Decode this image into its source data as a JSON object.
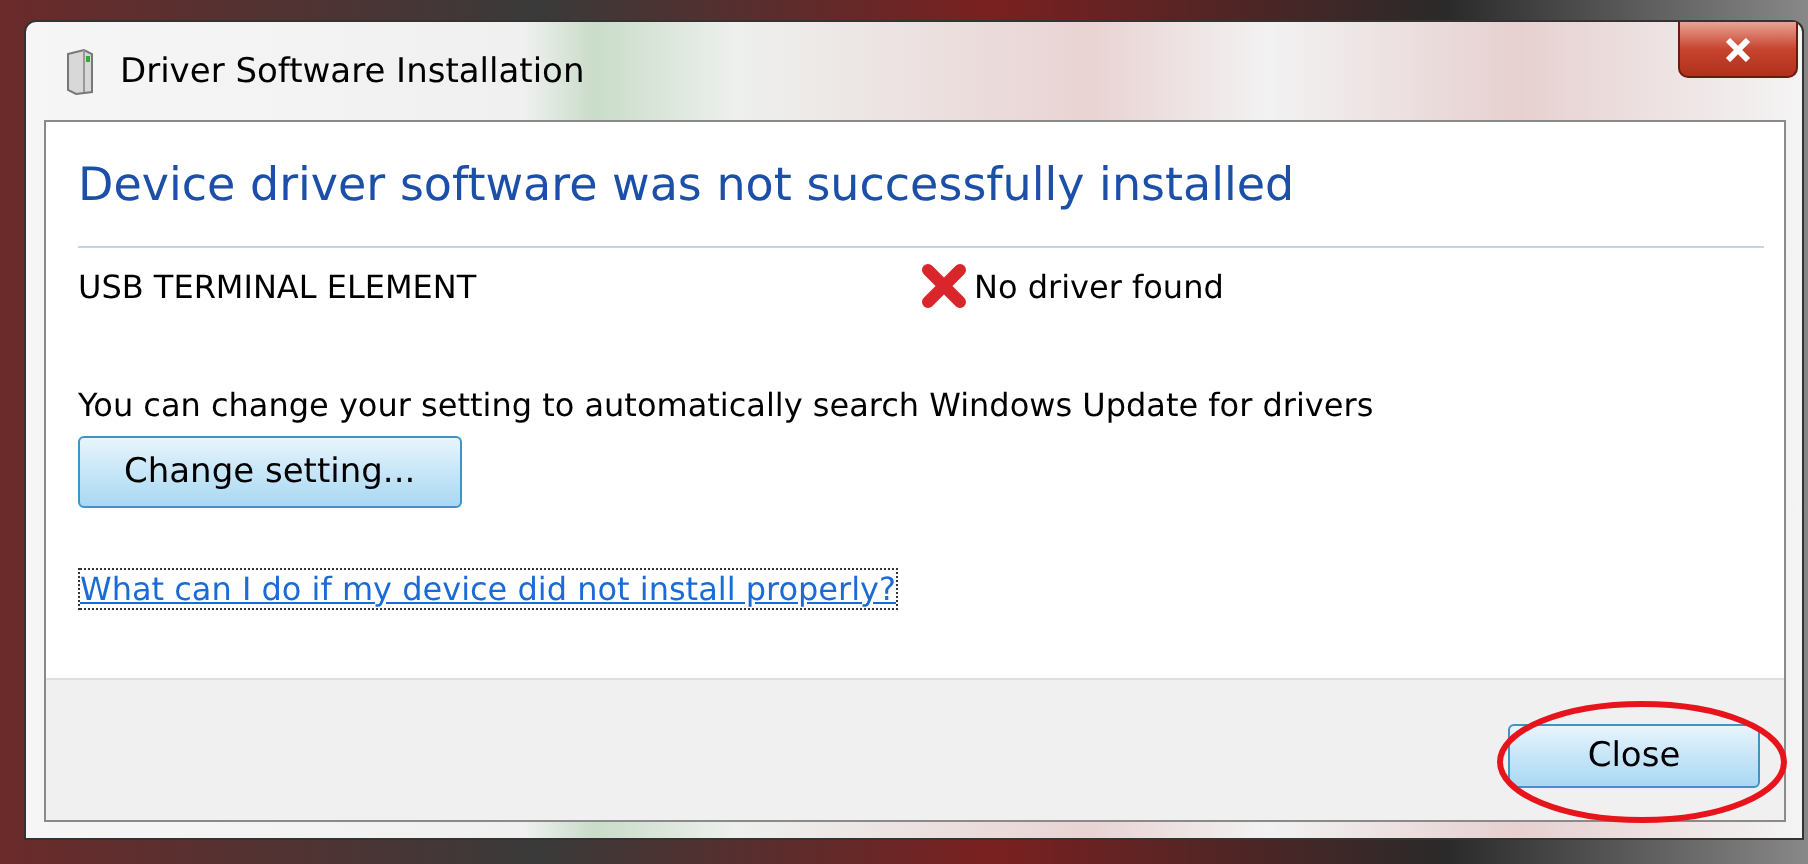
{
  "window": {
    "title": "Driver Software Installation"
  },
  "heading": "Device driver software was not successfully installed",
  "devices": [
    {
      "name": "USB TERMINAL ELEMENT",
      "status": "No driver found",
      "kind": "error"
    }
  ],
  "message": "You can change your setting to automatically search Windows Update for drivers",
  "change_button": {
    "label": "Change setting..."
  },
  "help_link": {
    "label": "What can I do if my device did not install properly?",
    "focused": true
  },
  "close_button": {
    "label": "Close",
    "highlighted": true
  }
}
